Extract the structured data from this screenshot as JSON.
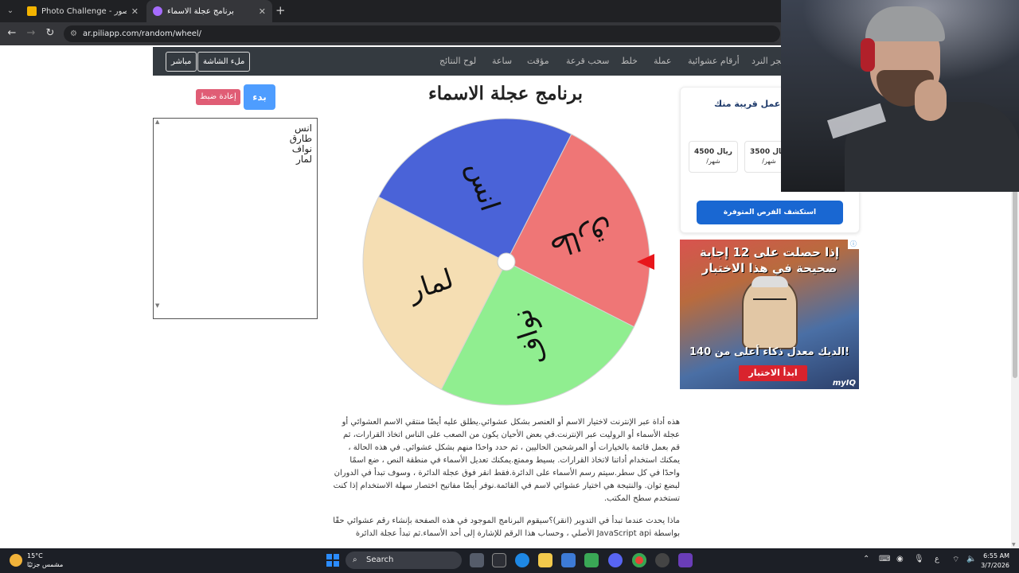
{
  "browser": {
    "tabs": [
      {
        "title": "Photo Challenge - تحدي الصور",
        "favicon_color": "#f4b400"
      },
      {
        "title": "برنامج عجلة الاسماء",
        "favicon_color": "#a66cff"
      }
    ],
    "close_glyph": "✕",
    "new_tab_glyph": "+",
    "url": "ar.piliapp.com/random/wheel/"
  },
  "navbar": {
    "links": [
      "حجر النرد",
      "أرقام عشوائية",
      "عملة",
      "خلط",
      "سحب قرعة",
      "ساعة",
      "مؤقت",
      "لوح النتائج"
    ],
    "fullscreen_label": "ملء الشاشة",
    "live_label": "مباشر"
  },
  "main": {
    "heading": "برنامج عجلة الاسماء",
    "start_label": "بدء",
    "reset_label": "إعادة ضبط",
    "names": [
      "انس",
      "طارق",
      "نواف",
      "لمار"
    ]
  },
  "chart_data": {
    "type": "pie",
    "slices": [
      {
        "label": "طارق",
        "color": "#ef7676"
      },
      {
        "label": "نواف",
        "color": "#90ee90"
      },
      {
        "label": "لمار",
        "color": "#f5deb3"
      },
      {
        "label": "انس",
        "color": "#4a63d8"
      }
    ],
    "pointer_color": "#e8161b"
  },
  "description": {
    "p1": "هذه أداة عبر الإنترنت لاختيار الاسم أو العنصر بشكل عشوائي.يطلق عليه أيضًا منتقي الاسم العشوائي أو عجلة الأسماء أو الروليت عبر الإنترنت.في بعض الأحيان يكون من الصعب على الناس اتخاذ القرارات، ثم قم بعمل قائمة بالخيارات أو المرشحين الحاليين ، ثم حدد واحدًا منهم بشكل عشوائي. في هذه الحالة ، يمكنك استخدام أداتنا لاتخاذ القرارات. بسيط وممتع.يمكنك تعديل الأسماء في منطقة النص ، ضع اسمًا واحدًا في كل سطر.سيتم رسم الأسماء على الدائرة.فقط انقر فوق عجلة الدائرة ، وسوف تبدأ في الدوران لبضع ثوان. والنتيجة هي اختيار عشوائي لاسم في القائمة.نوفر أيضًا مفاتيح اختصار سهلة الاستخدام إذا كنت تستخدم سطح المكتب.",
    "p2": "ماذا يحدث عندما تبدأ في التدوير (انقر)؟سيقوم البرنامج الموجود في هذه الصفحة بإنشاء رقم عشوائي حقًا بواسطة JavaScript api الأصلي ، وحساب هذا الرقم للإشارة إلى أحد الأسماء.ثم تبدأ عجلة الدائرة"
  },
  "sidebar": {
    "job_title": "فرص عمل قريبة منك",
    "salaries": [
      {
        "amount": "4500 ريال",
        "period": "/شهر"
      },
      {
        "amount": "3500 ريال",
        "period": "/شهر"
      }
    ],
    "explore_label": "استكشف الفرص المتوفرة",
    "ad": {
      "headline": "إذا حصلت على 12 إجابة صحيحة في هذا الاختبار",
      "subline": "الديك معدل ذكاء أعلى من 140!",
      "cta": "ابدأ الاختبار",
      "brand": "myIQ"
    }
  },
  "taskbar": {
    "temperature": "15°C",
    "weather": "مشمس جزئيًا",
    "search_placeholder": "Search",
    "lang": "ع",
    "time": "6:55 AM",
    "date": "3/7/2026"
  },
  "colors": {
    "navbar_bg": "#343a40",
    "start_btn": "#4e9dff",
    "reset_btn": "#e05d75",
    "explore_btn": "#1967d2"
  }
}
